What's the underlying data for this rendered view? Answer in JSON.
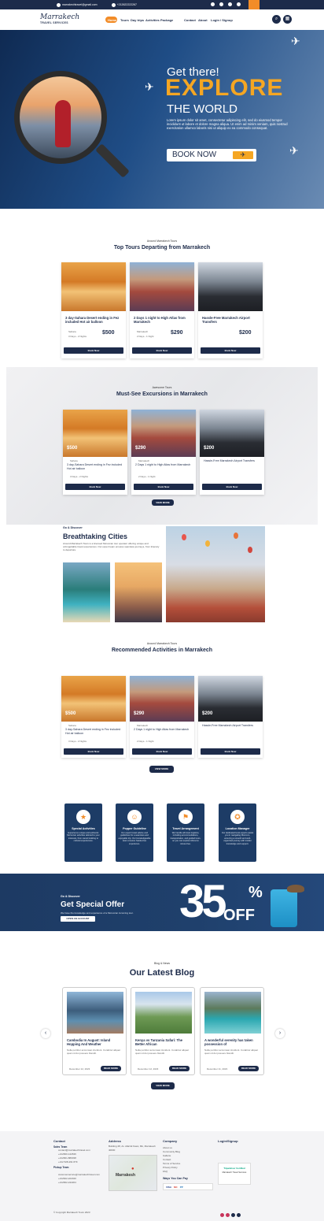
{
  "topbar": {
    "email": "marrakechtravel@gmail.com",
    "phone": "+212622222267"
  },
  "nav": {
    "logo_main": "Marrakech",
    "logo_sub": "TRAVEL SERVICES",
    "links": [
      "Home",
      "Tours",
      "Day trips",
      "Activities",
      "Package",
      "Contact",
      "About",
      "Login / Signup"
    ]
  },
  "hero": {
    "tag": "Get there!",
    "headline": "EXPLORE",
    "sub": "THE WORLD",
    "text": "Lorem ipsum dolor sit amet, consectetur adipiscing elit, sed do eiusmod tempor incididunt ut labore et dolore magna aliqua. Ut enim ad minim veniam, quis nostrud exercitation ullamco laboris nisi ut aliquip ex ea commodo consequat.",
    "button": "BOOK NOW"
  },
  "top_tours": {
    "kicker": "Around Marrakech Tours",
    "title": "Top Tours Departing from Marrakech",
    "cards": [
      {
        "title": "3 day-Sahara Desert ending in Fez included Hot air balloon",
        "loc": "Sahara",
        "dur": "3 Days - 2 Nights",
        "price": "$500",
        "button": "Book Now"
      },
      {
        "title": "2 Days 1 night  to High Atlas from Marrakech",
        "loc": "Marrakech",
        "dur": "2 Days - 1 Night",
        "price": "$290",
        "button": "Book Now"
      },
      {
        "title": "Hassle-Free Marrakech Airport Transfers",
        "loc": "",
        "dur": "",
        "price": "$200",
        "button": "Book Now"
      }
    ]
  },
  "excursions": {
    "kicker": "Awesome Tours",
    "title": "Must-See Excursions in Marrakech",
    "cards": [
      {
        "price": "$500",
        "title": "3 day-Sahara Desert ending in Fez included Hot air balloon",
        "loc": "Sahara",
        "dur": "3 Days - 2 Nights",
        "button": "Book Now"
      },
      {
        "price": "$290",
        "title": "2 Days 1 night  to High Atlas from Marrakech",
        "loc": "Marrakech",
        "dur": "2 Days - 1 Night",
        "button": "Book Now"
      },
      {
        "price": "$200",
        "title": "Hassle-Free Marrakech Airport Transfers",
        "loc": "",
        "dur": "",
        "button": "Book Now"
      }
    ],
    "view_more": "VIEW MORE"
  },
  "cities": {
    "kicker": "Go & Discover",
    "title": "Breathtaking Cities",
    "text": "Around Marrakech Tours is a licensed Moroccan tour operator offering unique and unforgettable travel experiences. Our expert team ensures seamless journeys, from itinerary to departure."
  },
  "activities": {
    "kicker": "Around Marrakech Tours",
    "title": "Recommended Activities in Marrakech",
    "cards": [
      {
        "price": "$500",
        "title": "3 day-Sahara Desert ending in Fez included Hot air balloon",
        "loc": "Sahara",
        "dur": "3 Days - 2 Nights",
        "button": "Book Now"
      },
      {
        "price": "$290",
        "title": "2 Days 1 night  to High Atlas from Marrakech",
        "loc": "Marrakech",
        "dur": "2 Days - 1 Night",
        "button": "Book Now"
      },
      {
        "price": "$200",
        "title": "Hassle-Free Marrakech Airport Transfers",
        "loc": "",
        "dur": "",
        "button": "Book Now"
      }
    ],
    "view_more": "VIEW MORE"
  },
  "services": [
    {
      "icon": "star-icon",
      "glyph": "★",
      "title": "Special Activities",
      "text": "Experience unique and authentic Moroccan activities tailored to your interests, from camel trekking to cultural experiences."
    },
    {
      "icon": "guide-icon",
      "glyph": "☺",
      "title": "Popper Guideline",
      "text": "Our expert travel advice and guidelines for a seamless and enjoyable trip. Our knowledgeable team ensures hassle-free experience."
    },
    {
      "icon": "route-icon",
      "glyph": "⚑",
      "title": "Travel Arrangement",
      "text": "We handle all travel logistics, including accommodations, transportation, and guided tours, so you can explore Morocco stress-free."
    },
    {
      "icon": "map-pin-icon",
      "glyph": "✪",
      "title": "Location Manager",
      "text": "Our dedicated local experts assist you in navigating Morocco, ensuring a smooth and well-organized journey with insider knowledge and support."
    }
  ],
  "offer": {
    "kicker": "Go & Discover",
    "title": "Get Special Offer",
    "text": "We have the knowledge and experience of a Moroccan incoming tour.",
    "button": "OPEN AN ACCOUNT",
    "big": "35",
    "pct": "%",
    "off": "OFF"
  },
  "blog": {
    "kicker": "Blog & News",
    "title": "Our Latest Blog",
    "posts": [
      {
        "title": "Cambodia In August: Island Hopping And Weather",
        "text": "Nulla porttitor accumsan tincidunt. Curabitur aliquet quam id dui posuere blandit.",
        "date": "December 12, 2023",
        "button": "READ MORE"
      },
      {
        "title": "Kenya vs Tanzania Safari: The Better African",
        "text": "Nulla porttitor accumsan tincidunt. Curabitur aliquet quam id dui posuere blandit.",
        "date": "December 12, 2023",
        "button": "READ MORE"
      },
      {
        "title": "A wonderful serenity has taken possession of",
        "text": "Nulla porttitor accumsan tincidunt. Curabitur aliquet quam id dui posuere blandit.",
        "date": "December 11, 2023",
        "button": "READ MORE"
      }
    ],
    "view_more": "VIEW MORE"
  },
  "footer": {
    "contact_h": "Contact",
    "sales_h": "Sales Team",
    "sales": [
      "contact@marrakechtravel.com",
      "+212660-142636",
      "+212661-880038",
      "+212 528-291 879"
    ],
    "pickup_h": "Pickup Team",
    "pickup": [
      "customerservice@marrakechtravel.com",
      "+212622-222040",
      "+212662-242204"
    ],
    "address_h": "Address",
    "address": "Building 28, Av. Allal El Fassi, Mk, Marrakesh 40030",
    "map_label": "Marrakesh",
    "company_h": "Company",
    "company": [
      "About us",
      "Community Blog",
      "Gallerie",
      "Contact",
      "Terms of Service",
      "Privacy Policy",
      "FAQ"
    ],
    "pay_h": "Ways You Can Pay",
    "pay": [
      "VISA",
      "MC",
      "PP"
    ],
    "login_h": "Login/Signup",
    "ta_badge": "Tripadvisor Certified",
    "ta_sub": "Marrakech Travel Services",
    "copyright": "© Copyright Marrakech Tours 2023"
  }
}
